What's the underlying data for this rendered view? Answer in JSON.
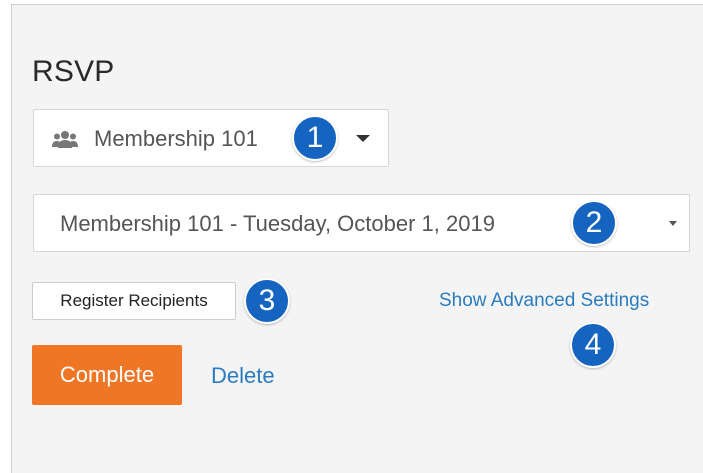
{
  "panel": {
    "title": "RSVP"
  },
  "group_select": {
    "icon": "users-icon",
    "value": "Membership 101"
  },
  "occurrence_select": {
    "value": "Membership 101 - Tuesday, October 1, 2019"
  },
  "actions": {
    "register_label": "Register Recipients",
    "advanced_label": "Show Advanced Settings",
    "complete_label": "Complete",
    "delete_label": "Delete"
  },
  "callouts": [
    "1",
    "2",
    "3",
    "4"
  ],
  "colors": {
    "accent_orange": "#ee7625",
    "link_blue": "#2a7cbf",
    "callout_blue": "#1565c0"
  }
}
